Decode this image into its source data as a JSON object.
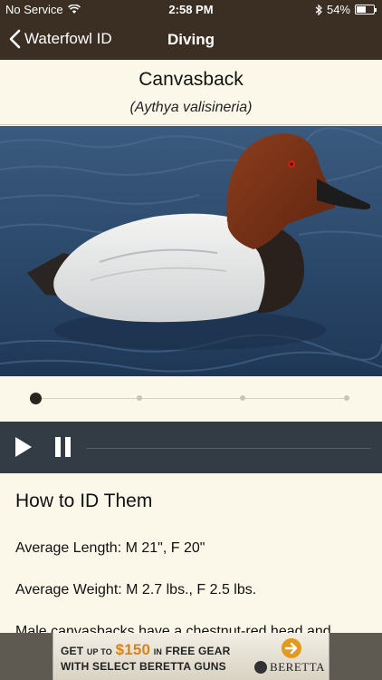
{
  "status_bar": {
    "carrier": "No Service",
    "time": "2:58 PM",
    "battery": "54%",
    "battery_level": 0.54
  },
  "nav": {
    "back_label": "Waterfowl ID",
    "title": "Diving"
  },
  "bird": {
    "name": "Canvasback",
    "scientific_name": "(Aythya valisineria)"
  },
  "gallery": {
    "page_count": 4,
    "current_page": 1
  },
  "player": {
    "progress": 0.0
  },
  "content": {
    "heading": "How to ID Them",
    "length": "Average Length: M 21\", F 20\"",
    "weight": "Average Weight: M 2.7 lbs., F 2.5 lbs.",
    "description": "Male canvasbacks have a chestnut-red head and"
  },
  "ad": {
    "line1_pre": "GET",
    "line1_up": "UP TO",
    "line1_amount": "$150",
    "line1_in": "IN",
    "line1_post": "FREE GEAR",
    "line2": "WITH SELECT BERETTA GUNS",
    "brand": "BERETTA",
    "accent_color": "#e29b1e"
  },
  "colors": {
    "header_bg": "#3a2f22",
    "page_bg": "#fbf8ea",
    "player_bg": "#333b44"
  }
}
